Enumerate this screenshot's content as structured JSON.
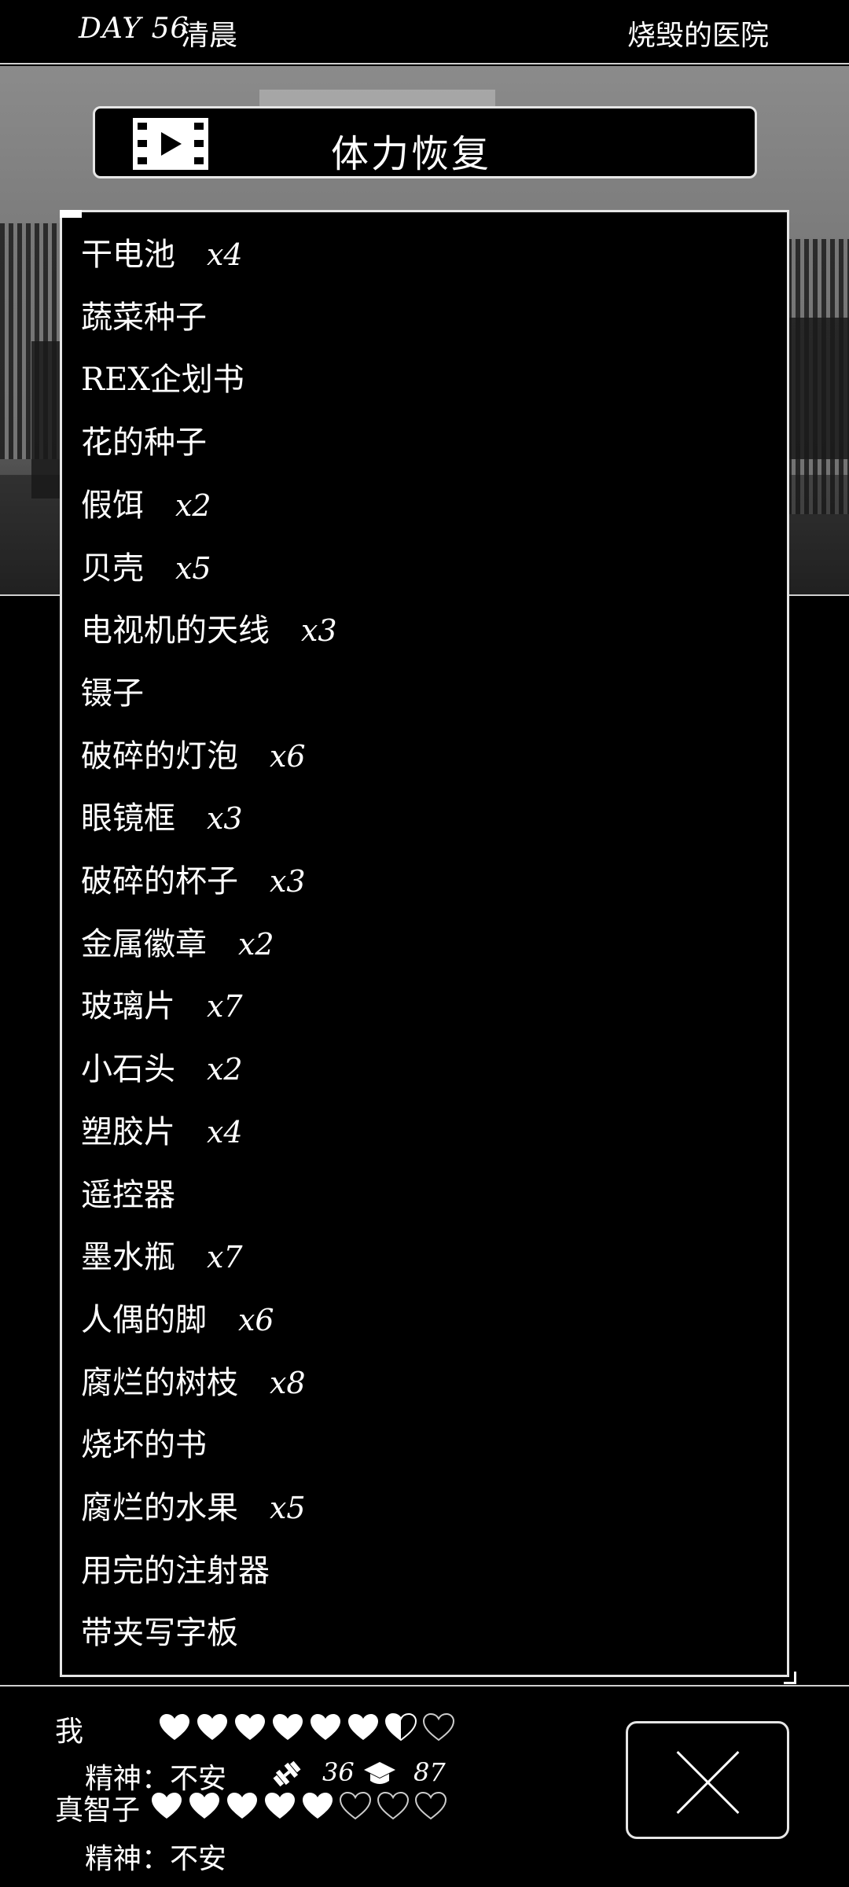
{
  "header": {
    "day": "DAY 56",
    "time": "清晨",
    "location": "烧毁的医院"
  },
  "title_bar": {
    "title": "体力恢复",
    "icon": "video-play-icon"
  },
  "items": [
    {
      "name": "干电池",
      "qty": "x4"
    },
    {
      "name": "蔬菜种子",
      "qty": ""
    },
    {
      "name": "REX企划书",
      "qty": ""
    },
    {
      "name": "花的种子",
      "qty": ""
    },
    {
      "name": "假饵",
      "qty": "x2"
    },
    {
      "name": "贝壳",
      "qty": "x5"
    },
    {
      "name": "电视机的天线",
      "qty": "x3"
    },
    {
      "name": "镊子",
      "qty": ""
    },
    {
      "name": "破碎的灯泡",
      "qty": "x6"
    },
    {
      "name": "眼镜框",
      "qty": "x3"
    },
    {
      "name": "破碎的杯子",
      "qty": "x3"
    },
    {
      "name": "金属徽章",
      "qty": "x2"
    },
    {
      "name": "玻璃片",
      "qty": "x7"
    },
    {
      "name": "小石头",
      "qty": "x2"
    },
    {
      "name": "塑胶片",
      "qty": "x4"
    },
    {
      "name": "遥控器",
      "qty": ""
    },
    {
      "name": "墨水瓶",
      "qty": "x7"
    },
    {
      "name": "人偶的脚",
      "qty": "x6"
    },
    {
      "name": "腐烂的树枝",
      "qty": "x8"
    },
    {
      "name": "烧坏的书",
      "qty": ""
    },
    {
      "name": "腐烂的水果",
      "qty": "x5"
    },
    {
      "name": "用完的注射器",
      "qty": ""
    },
    {
      "name": "带夹写字板",
      "qty": ""
    }
  ],
  "status": {
    "player": {
      "name": "我",
      "hearts_full": 6,
      "hearts_half": 1,
      "hearts_total": 8,
      "mind_label": "精神：",
      "mind_value": "不安",
      "strength_icon": "dumbbell-icon",
      "strength": "36",
      "intellect_icon": "graduation-cap-icon",
      "intellect": "87"
    },
    "companion": {
      "name": "真智子",
      "hearts_full": 5,
      "hearts_half": 0,
      "hearts_total": 8,
      "mind_label": "精神：",
      "mind_value": "不安"
    }
  },
  "close_button": {
    "icon": "close-icon"
  },
  "colors": {
    "background": "#000000",
    "foreground": "#ffffff",
    "border": "#e6e6e6"
  }
}
